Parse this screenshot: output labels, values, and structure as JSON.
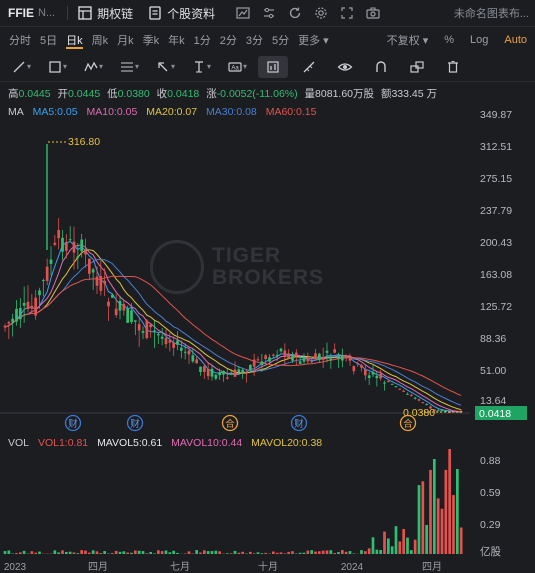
{
  "header": {
    "ticker": "FFIE",
    "name": "N...",
    "options_chain": "期权链",
    "profile": "个股资料",
    "layout_name": "未命名图表布..."
  },
  "periods": [
    "分时",
    "5日",
    "日k",
    "周k",
    "月k",
    "季k",
    "年k",
    "1分",
    "2分",
    "3分",
    "5分",
    "更多"
  ],
  "period_active": "日k",
  "period_right": {
    "adjust": "不复权",
    "percent": "%",
    "log": "Log",
    "auto": "Auto"
  },
  "ohlc": {
    "high_label": "高",
    "high": "0.0445",
    "open_label": "开",
    "open": "0.0445",
    "low_label": "低",
    "low": "0.0380",
    "close_label": "收",
    "close": "0.0418",
    "change_label": "涨",
    "change": "-0.0052(-11.06%)",
    "volume_label": "量",
    "volume": "8081.60万股",
    "amount_label": "额",
    "amount": "333.45 万"
  },
  "ma": {
    "label": "MA",
    "items": [
      {
        "text": "MA5:0.05",
        "color": "#3aa0f2"
      },
      {
        "text": "MA10:0.05",
        "color": "#e06bb3"
      },
      {
        "text": "MA20:0.07",
        "color": "#e0c43f"
      },
      {
        "text": "MA30:0.08",
        "color": "#4a7fd1"
      },
      {
        "text": "MA60:0.15",
        "color": "#e2534f"
      }
    ]
  },
  "vol": {
    "label": "VOL",
    "items": [
      {
        "text": "VOL1:0.81",
        "color": "#e2534f"
      },
      {
        "text": "MAVOL5:0.61",
        "color": "#e8e9ec"
      },
      {
        "text": "MAVOL10:0.44",
        "color": "#e06bb3"
      },
      {
        "text": "MAVOL20:0.38",
        "color": "#e0c43f"
      }
    ],
    "axis": [
      "0.88",
      "0.59",
      "0.29"
    ],
    "unit": "亿股"
  },
  "price_axis": [
    "349.87",
    "312.51",
    "275.15",
    "237.79",
    "200.43",
    "163.08",
    "125.72",
    "88.36",
    "51.00",
    "13.64"
  ],
  "markers": {
    "max_label": "316.80",
    "min_label": "0.0380",
    "last_price": "0.0418"
  },
  "events": [
    "财",
    "财",
    "合",
    "财",
    "合"
  ],
  "date_axis": [
    "2023",
    "四月",
    "七月",
    "十月",
    "2024",
    "四月"
  ],
  "watermark": {
    "line1": "TIGER",
    "line2": "BROKERS"
  },
  "colors": {
    "up": "#2fbf71",
    "down": "#e2534f",
    "accent": "#e8a33d",
    "bg": "#1c1d21",
    "last_price_bg": "#1fa463"
  }
}
